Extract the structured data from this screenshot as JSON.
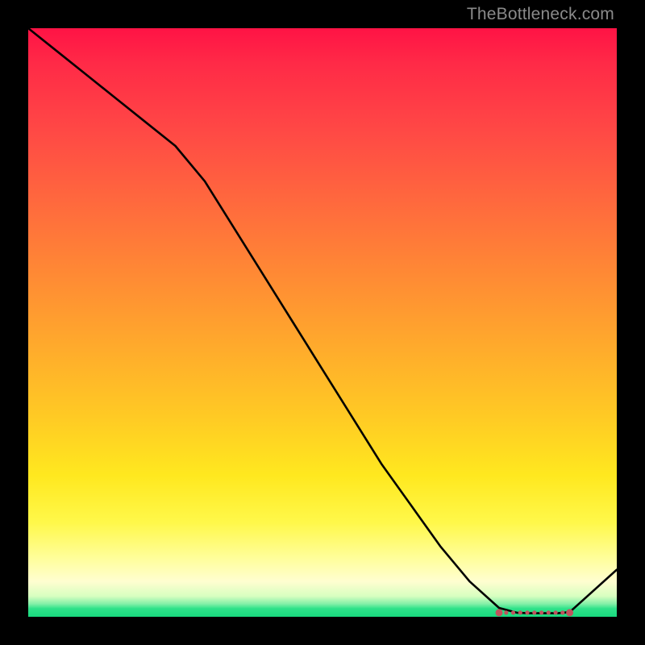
{
  "attribution": "TheBottleneck.com",
  "chart_data": {
    "type": "line",
    "title": "",
    "xlabel": "",
    "ylabel": "",
    "xlim": [
      0,
      100
    ],
    "ylim": [
      0,
      100
    ],
    "x": [
      0,
      5,
      10,
      15,
      20,
      25,
      30,
      35,
      40,
      45,
      50,
      55,
      60,
      65,
      70,
      75,
      80,
      83,
      85,
      88,
      90,
      92,
      100
    ],
    "values": [
      100,
      96,
      92,
      88,
      84,
      80,
      74,
      66,
      58,
      50,
      42,
      34,
      26,
      19,
      12,
      6,
      1.5,
      0.7,
      0.6,
      0.6,
      0.6,
      0.8,
      8
    ],
    "marker_region": {
      "start_x": 80,
      "end_x": 92,
      "y": 0.7
    },
    "background": "heat-gradient-red-to-green"
  }
}
